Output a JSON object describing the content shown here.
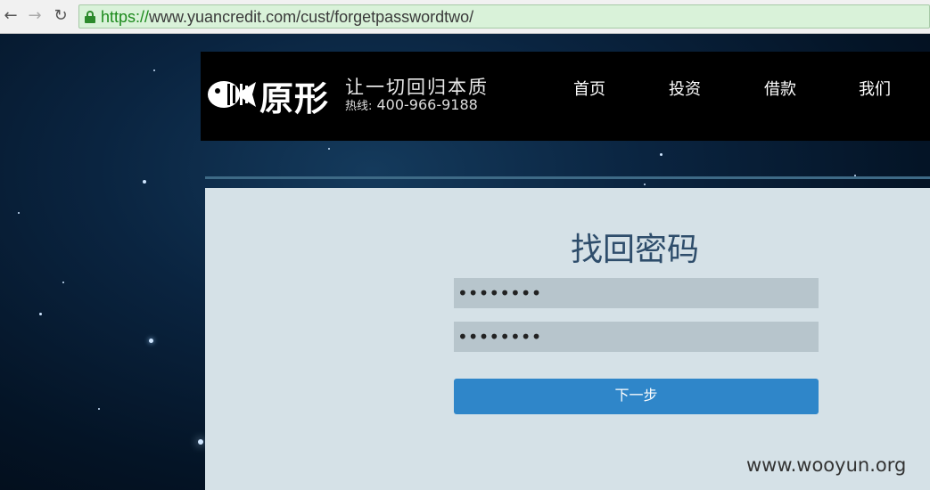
{
  "browser": {
    "back_icon": "←",
    "forward_icon": "→",
    "reload_icon": "↻",
    "url_scheme": "https://",
    "url_rest": "www.yuancredit.com/cust/forgetpasswordtwo/"
  },
  "header": {
    "logo_text": "原形",
    "slogan": "让一切回归本质",
    "hotline_label": "热线:",
    "hotline_number": "400-966-9188",
    "nav": [
      "首页",
      "投资",
      "借款",
      "我们"
    ]
  },
  "form": {
    "title": "找回密码",
    "password_value": "••••••••",
    "confirm_value": "••••••••",
    "next_label": "下一步"
  },
  "watermark": "www.wooyun.org"
}
